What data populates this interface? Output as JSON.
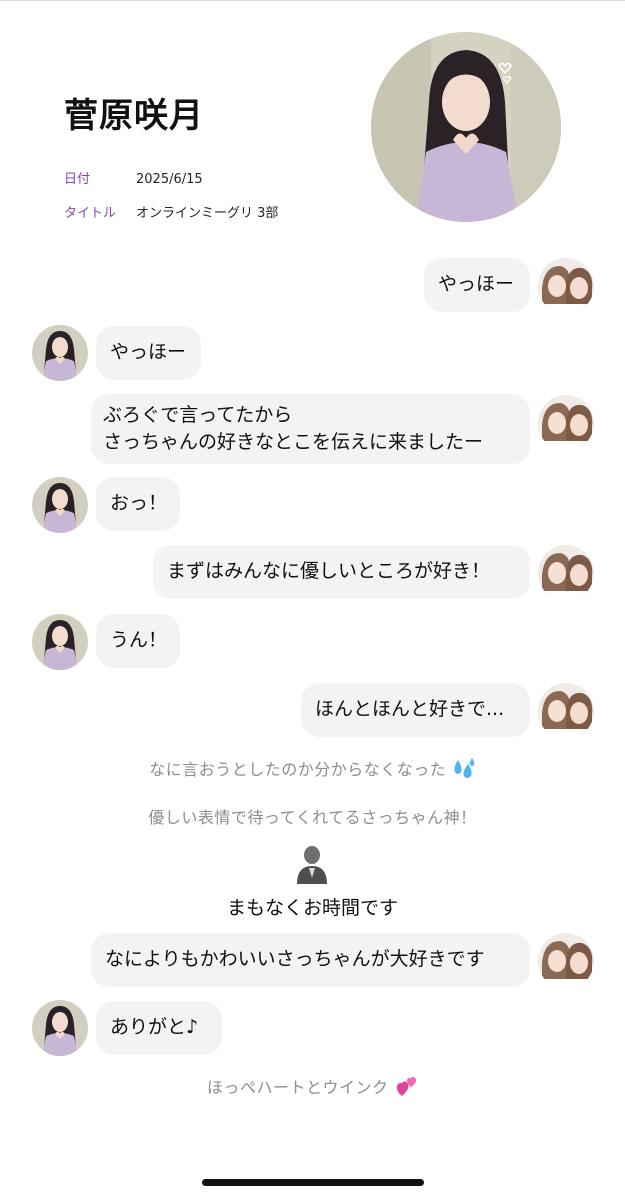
{
  "header": {
    "name": "菅原咲月",
    "date_label": "日付",
    "date_value": "2025/6/15",
    "title_label": "タイトル",
    "title_value": "オンラインミーグリ 3部"
  },
  "messages": [
    {
      "side": "right",
      "text": "やっほー"
    },
    {
      "side": "left",
      "text": "やっほー"
    },
    {
      "side": "right",
      "lines": [
        "ぶろぐで言ってたから",
        "さっちゃんの好きなとこを伝えに来ましたー"
      ]
    },
    {
      "side": "left",
      "text": "おっ！"
    },
    {
      "side": "right",
      "text": "まずはみんなに優しいところが好き！"
    },
    {
      "side": "left",
      "text": "うん！"
    },
    {
      "side": "right",
      "text": "ほんとほんと好きで..."
    },
    {
      "side": "right",
      "text": "なによりもかわいいさっちゃんが大好きです"
    },
    {
      "side": "left",
      "text": "ありがと♪"
    }
  ],
  "narration": {
    "line1": "なに言おうとしたのか分からなくなった",
    "line1_emoji": "sweat-droplets-icon",
    "line2": "優しい表情で待ってくれてるさっちゃん神！",
    "staff_notice": "まもなくお時間です",
    "staff_icon": "staff-silhouette-icon",
    "line3": "ほっぺハートとウインク",
    "line3_emoji": "two-hearts-icon"
  },
  "colors": {
    "label_purple": "#8a43b8",
    "bubble_bg": "#f3f3f3",
    "narration_gray": "#8d8d8d",
    "sweat_blue": "#4fb3ef",
    "heart_pink": "#e0439b"
  }
}
